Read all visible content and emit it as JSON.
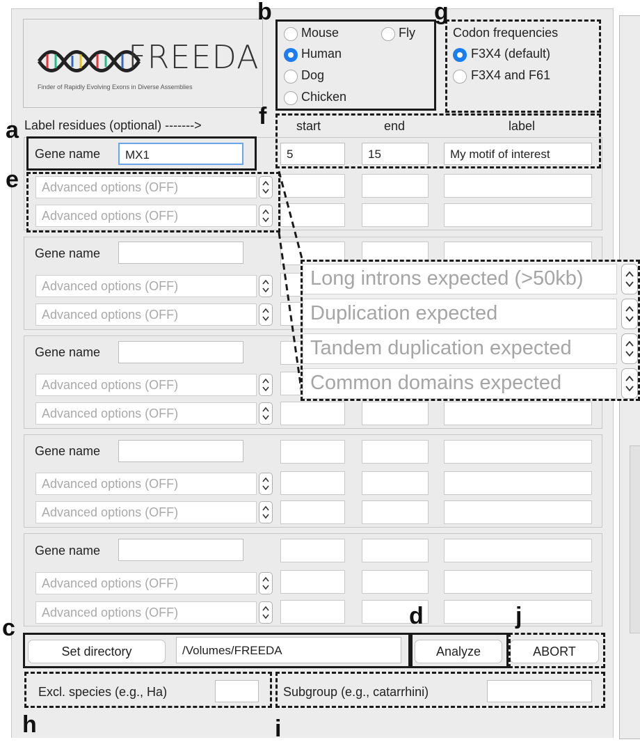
{
  "logo": {
    "text": "FREEDA",
    "tagline": "Finder of Rapidly Evolving Exons in Diverse Assemblies"
  },
  "species": {
    "options": [
      "Mouse",
      "Fly",
      "Human",
      "Dog",
      "Chicken"
    ],
    "selected": "Human"
  },
  "codon": {
    "title": "Codon frequencies",
    "options": [
      "F3X4 (default)",
      "F3X4 and F61"
    ],
    "selected": "F3X4 (default)"
  },
  "label_residues": {
    "title": "Label residues (optional) ------->",
    "col_start": "start",
    "col_end": "end",
    "col_label": "label",
    "row1": {
      "start": "5",
      "end": "15",
      "label": "My motif of interest"
    }
  },
  "gene": {
    "label": "Gene name",
    "first_value": "MX1",
    "advanced_placeholder": "Advanced options (OFF)"
  },
  "advanced_menu": {
    "items": [
      "Long introns expected (>50kb)",
      "Duplication expected",
      "Tandem duplication expected",
      "Common domains expected"
    ]
  },
  "bottom": {
    "set_directory": "Set directory",
    "directory_path": "/Volumes/FREEDA",
    "analyze": "Analyze",
    "abort": "ABORT",
    "excl_species": "Excl. species (e.g., Ha)",
    "subgroup": "Subgroup (e.g., catarrhini)"
  },
  "annotations": [
    "a",
    "b",
    "c",
    "d",
    "e",
    "f",
    "g",
    "h",
    "i",
    "j"
  ]
}
